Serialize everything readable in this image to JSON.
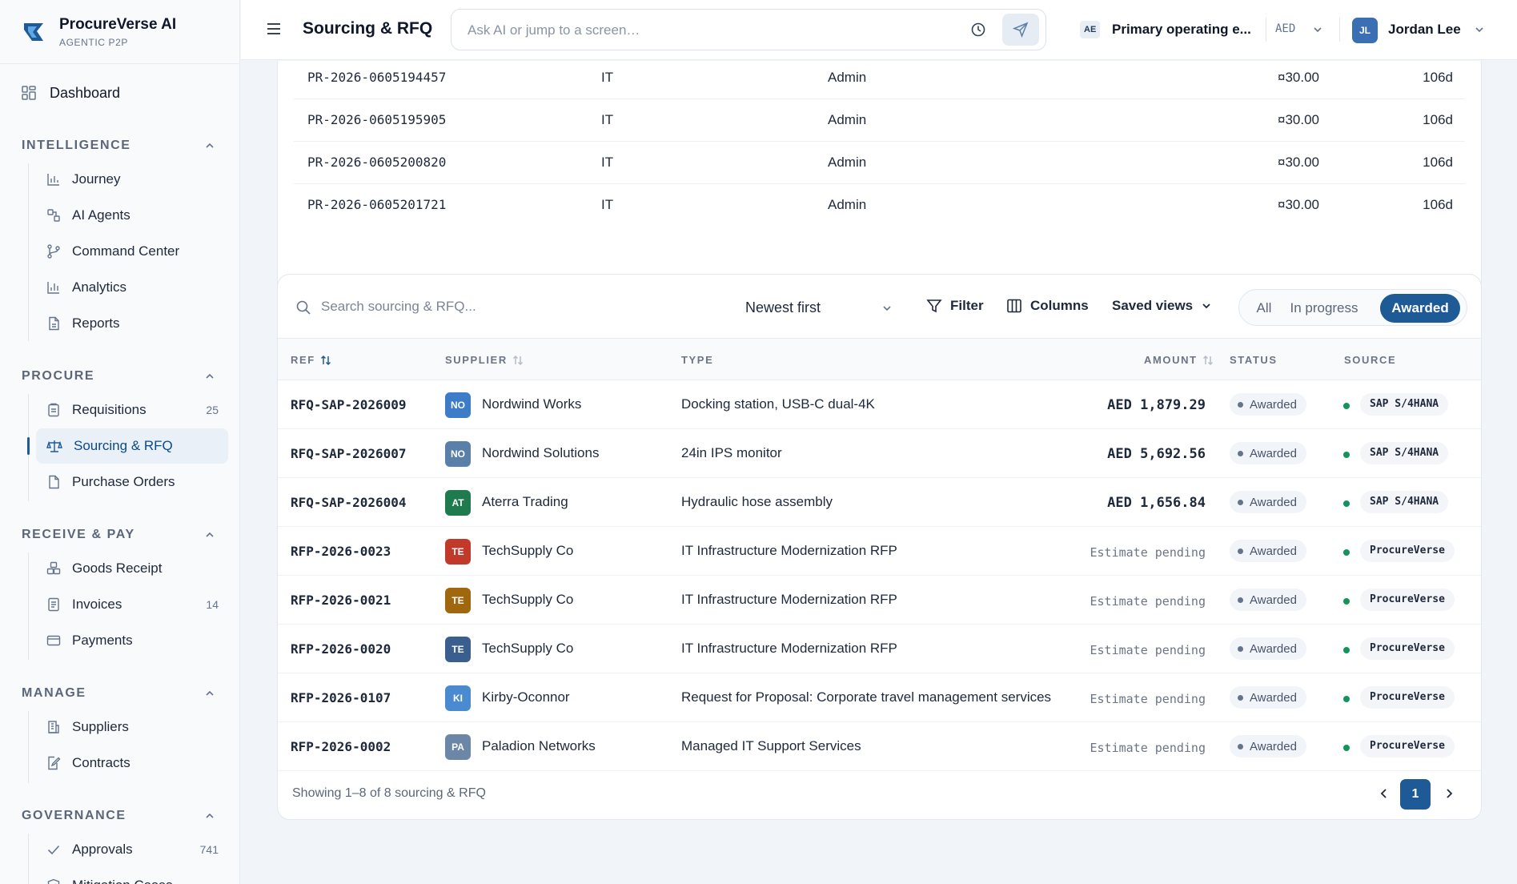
{
  "brand": {
    "name": "ProcureVerse AI",
    "tagline": "AGENTIC P2P"
  },
  "sidebar": {
    "dashboard": "Dashboard",
    "sections": {
      "intelligence": {
        "title": "INTELLIGENCE",
        "items": [
          "Journey",
          "AI Agents",
          "Command Center",
          "Analytics",
          "Reports"
        ]
      },
      "procure": {
        "title": "PROCURE",
        "items": [
          {
            "label": "Requisitions",
            "count": "25"
          },
          {
            "label": "Sourcing & RFQ",
            "count": ""
          },
          {
            "label": "Purchase Orders",
            "count": ""
          }
        ]
      },
      "receive_pay": {
        "title": "RECEIVE & PAY",
        "items": [
          {
            "label": "Goods Receipt",
            "count": ""
          },
          {
            "label": "Invoices",
            "count": "14"
          },
          {
            "label": "Payments",
            "count": ""
          }
        ]
      },
      "manage": {
        "title": "MANAGE",
        "items": [
          "Suppliers",
          "Contracts"
        ]
      },
      "governance": {
        "title": "GOVERNANCE",
        "items": [
          {
            "label": "Approvals",
            "count": "741"
          },
          {
            "label": "Mitigation Cases",
            "count": ""
          }
        ]
      }
    }
  },
  "header": {
    "title": "Sourcing & RFQ",
    "search_placeholder": "Ask AI or jump to a screen…",
    "entity_badge": "AE",
    "entity_name": "Primary operating e...",
    "currency": "AED",
    "user_initials": "JL",
    "user_name": "Jordan Lee"
  },
  "pr_rows": [
    {
      "ref": "PR-2026-0605194457",
      "dept": "IT",
      "requester": "Admin",
      "amount": "¤30.00",
      "age": "106d"
    },
    {
      "ref": "PR-2026-0605195905",
      "dept": "IT",
      "requester": "Admin",
      "amount": "¤30.00",
      "age": "106d"
    },
    {
      "ref": "PR-2026-0605200820",
      "dept": "IT",
      "requester": "Admin",
      "amount": "¤30.00",
      "age": "106d"
    },
    {
      "ref": "PR-2026-0605201721",
      "dept": "IT",
      "requester": "Admin",
      "amount": "¤30.00",
      "age": "106d"
    }
  ],
  "toolbar": {
    "search_placeholder": "Search sourcing & RFQ...",
    "sort": "Newest first",
    "filter": "Filter",
    "columns": "Columns",
    "saved_views": "Saved views",
    "segments": [
      "All",
      "In progress",
      "Awarded"
    ],
    "active_segment": "Awarded"
  },
  "table": {
    "headers": {
      "ref": "REF",
      "supplier": "SUPPLIER",
      "type": "TYPE",
      "amount": "AMOUNT",
      "status": "STATUS",
      "source": "SOURCE"
    },
    "rows": [
      {
        "ref": "RFQ-SAP-2026009",
        "initials": "NO",
        "badge_color": "#3d7cc9",
        "supplier": "Nordwind Works",
        "type": "Docking station, USB-C dual-4K",
        "amount": "AED 1,879.29",
        "pending": false,
        "status": "Awarded",
        "source": "SAP S/4HANA"
      },
      {
        "ref": "RFQ-SAP-2026007",
        "initials": "NO",
        "badge_color": "#5a7fa8",
        "supplier": "Nordwind Solutions",
        "type": "24in IPS monitor",
        "amount": "AED 5,692.56",
        "pending": false,
        "status": "Awarded",
        "source": "SAP S/4HANA"
      },
      {
        "ref": "RFQ-SAP-2026004",
        "initials": "AT",
        "badge_color": "#1f7a4d",
        "supplier": "Aterra Trading",
        "type": "Hydraulic hose assembly",
        "amount": "AED 1,656.84",
        "pending": false,
        "status": "Awarded",
        "source": "SAP S/4HANA"
      },
      {
        "ref": "RFP-2026-0023",
        "initials": "TE",
        "badge_color": "#c0392b",
        "supplier": "TechSupply Co",
        "type": "IT Infrastructure Modernization RFP",
        "amount": "Estimate pending",
        "pending": true,
        "status": "Awarded",
        "source": "ProcureVerse"
      },
      {
        "ref": "RFP-2026-0021",
        "initials": "TE",
        "badge_color": "#a0670e",
        "supplier": "TechSupply Co",
        "type": "IT Infrastructure Modernization RFP",
        "amount": "Estimate pending",
        "pending": true,
        "status": "Awarded",
        "source": "ProcureVerse"
      },
      {
        "ref": "RFP-2026-0020",
        "initials": "TE",
        "badge_color": "#3a5f8f",
        "supplier": "TechSupply Co",
        "type": "IT Infrastructure Modernization RFP",
        "amount": "Estimate pending",
        "pending": true,
        "status": "Awarded",
        "source": "ProcureVerse"
      },
      {
        "ref": "RFP-2026-0107",
        "initials": "KI",
        "badge_color": "#4a8ad1",
        "supplier": "Kirby-Oconnor",
        "type": "Request for Proposal: Corporate travel management services",
        "amount": "Estimate pending",
        "pending": true,
        "status": "Awarded",
        "source": "ProcureVerse"
      },
      {
        "ref": "RFP-2026-0002",
        "initials": "PA",
        "badge_color": "#6b86a6",
        "supplier": "Paladion Networks",
        "type": "Managed IT Support Services",
        "amount": "Estimate pending",
        "pending": true,
        "status": "Awarded",
        "source": "ProcureVerse"
      }
    ]
  },
  "footer": {
    "showing": "Showing 1–8 of 8 sourcing & RFQ",
    "page": "1"
  },
  "colors": {
    "accent": "#1e5a96",
    "source_dot": "#15935b"
  }
}
